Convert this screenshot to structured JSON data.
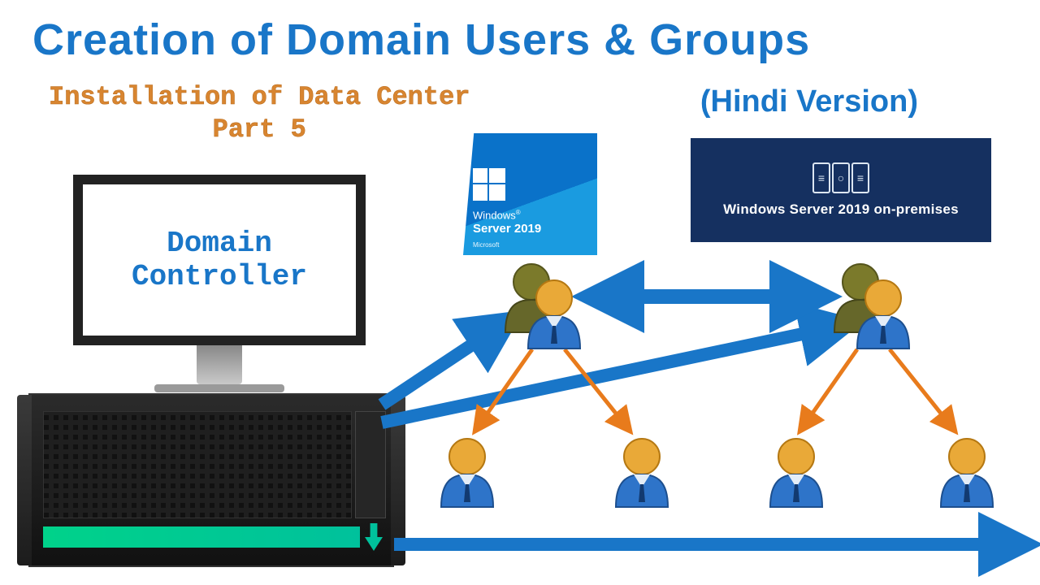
{
  "title": "Creation of Domain Users & Groups",
  "subtitle_line1": "Installation of Data Center",
  "subtitle_line2": "Part 5",
  "hindi": "(Hindi Version)",
  "monitor_label_line1": "Domain",
  "monitor_label_line2": "Controller",
  "ws_box": {
    "brand": "Windows",
    "product": "Server 2019",
    "vendor": "Microsoft"
  },
  "onprem_label": "Windows Server 2019 on-premises",
  "diagram": {
    "description": "A Domain Controller (server + monitor) connects via blue arrows to two user-group clusters (olive+blue figures). The two groups exchange data (blue double arrow). Each group fans out via orange arrows to two individual blue users, totalling four users along a bottom blue timeline arrow.",
    "nodes": {
      "group_left": "user-group",
      "group_right": "user-group",
      "user_1": "user",
      "user_2": "user",
      "user_3": "user",
      "user_4": "user"
    },
    "edges": [
      {
        "from": "domain_controller",
        "to": "group_left",
        "color": "#1976c8",
        "style": "thick"
      },
      {
        "from": "domain_controller",
        "to": "group_right",
        "color": "#1976c8",
        "style": "thick"
      },
      {
        "from": "group_left",
        "to": "group_right",
        "color": "#1976c8",
        "style": "double"
      },
      {
        "from": "group_left",
        "to": "user_1",
        "color": "#e87b1c",
        "style": "thin"
      },
      {
        "from": "group_left",
        "to": "user_2",
        "color": "#e87b1c",
        "style": "thin"
      },
      {
        "from": "group_right",
        "to": "user_3",
        "color": "#e87b1c",
        "style": "thin"
      },
      {
        "from": "group_right",
        "to": "user_4",
        "color": "#e87b1c",
        "style": "thin"
      }
    ],
    "baseline_arrow": {
      "color": "#1976c8"
    }
  }
}
